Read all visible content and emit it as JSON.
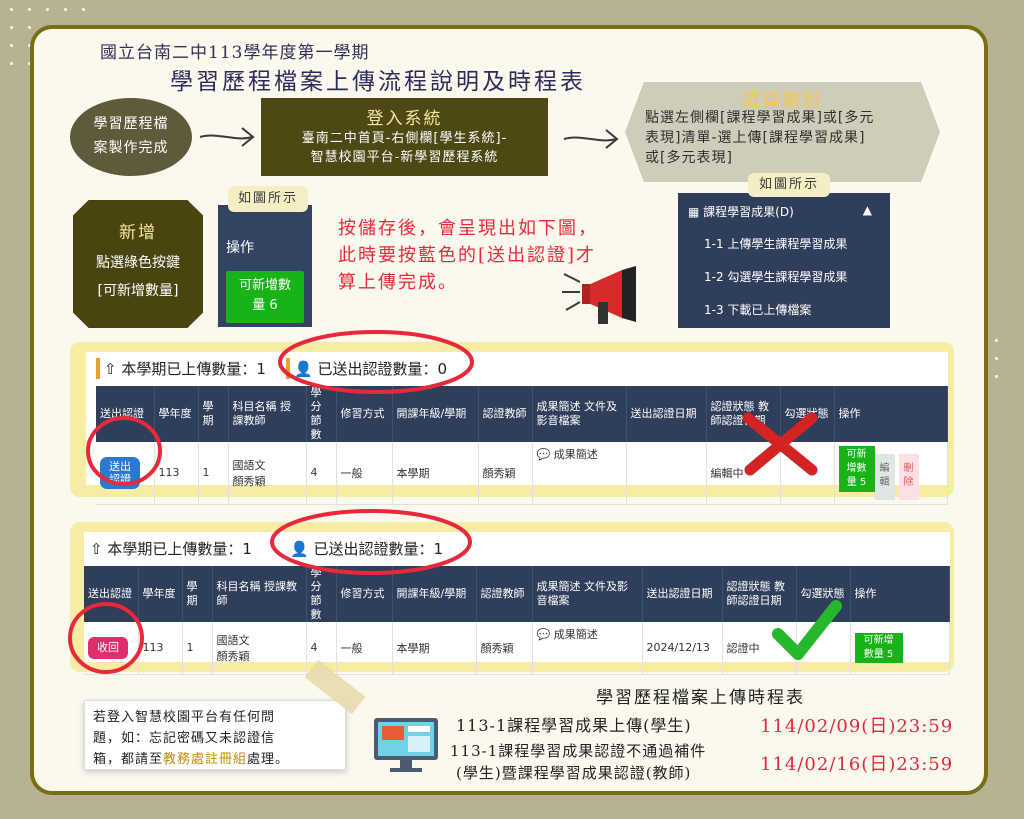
{
  "header": {
    "school_line": "國立台南二中113學年度第一學期",
    "main_title": "學習歷程檔案上傳流程說明及時程表"
  },
  "flow": {
    "step1": [
      "學習歷程檔",
      "案製作完成"
    ],
    "step2_title": "登入系統",
    "step2_body": [
      "臺南二中首頁-右側欄[學生系統]-",
      "智慧校園平台-新學習歷程系統"
    ],
    "step3_title": "選擇類別",
    "step3_body": [
      "點選左側欄[課程學習成果]或[多元",
      "表現]清單-選上傳[課程學習成果]",
      "或[多元表現]"
    ],
    "tag_as_shown": "如圖所示",
    "add_title": "新增",
    "add_body": [
      "點選綠色按鍵",
      "[可新增數量]"
    ],
    "op_label": "操作",
    "op_button": [
      "可新增數",
      "量 6"
    ],
    "note": [
      "按儲存後，會呈現出如下圖，",
      "此時要按藍色的[送出認證]才",
      "算上傳完成。"
    ]
  },
  "menu": {
    "header": "課程學習成果(D)",
    "items": [
      "1-1 上傳學生課程學習成果",
      "1-2 勾選學生課程學習成果",
      "1-3 下載已上傳檔案"
    ]
  },
  "table_headers": [
    "送出認證",
    "學年度",
    "學期",
    "科目名稱 授課教師",
    "學分 節數",
    "修習方式",
    "開課年級/學期",
    "認證教師",
    "成果簡述 文件及影音檔案",
    "送出認證日期",
    "認證狀態 教師認證日期",
    "勾選狀態",
    "操作"
  ],
  "panel1": {
    "uploaded": "本學期已上傳數量：1",
    "sent": "已送出認證數量：0",
    "row": {
      "btn": [
        "送出",
        "認證"
      ],
      "year": "113",
      "sem": "1",
      "subject": "國語文",
      "teacher": "顏秀穎",
      "credits": "4",
      "mode": "一般",
      "term": "本學期",
      "cert_teacher": "顏秀穎",
      "desc": "成果簡述",
      "date": "",
      "status": "編輯中",
      "op_add": [
        "可新",
        "增數",
        "量 5"
      ],
      "op_edit": [
        "編",
        "輯"
      ],
      "op_del": [
        "刪",
        "除"
      ]
    }
  },
  "panel2": {
    "uploaded": "本學期已上傳數量：1",
    "sent": "已送出認證數量：1",
    "row": {
      "btn": "收回",
      "year": "113",
      "sem": "1",
      "subject": "國語文",
      "teacher": "顏秀穎",
      "credits": "4",
      "mode": "一般",
      "term": "本學期",
      "cert_teacher": "顏秀穎",
      "desc": "成果簡述",
      "date": "2024/12/13",
      "status": "認證中",
      "op_add": [
        "可新增",
        "數量 5"
      ]
    }
  },
  "help": {
    "lines": [
      "若登入智慧校園平台有任何問",
      "題，如：忘記密碼又未認證信",
      "箱，都請至",
      "教務處註冊組",
      "處理。"
    ],
    "highlight_color": "#c58a00"
  },
  "schedule": {
    "title": "學習歷程檔案上傳時程表",
    "row1": "113-1課程學習成果上傳(學生)",
    "row1_date": "114/02/09(日)23:59",
    "row2a": "113-1課程學習成果認證不通過補件",
    "row2b": "(學生)暨課程學習成果認證(教師)",
    "row2_date": "114/02/16(日)23:59"
  },
  "colors": {
    "background": "#b7b291",
    "frame": "#7a6e12",
    "accent_red": "#e8283b",
    "table_header": "#2f3f5b",
    "green": "#17b317",
    "blue": "#2979d0"
  }
}
